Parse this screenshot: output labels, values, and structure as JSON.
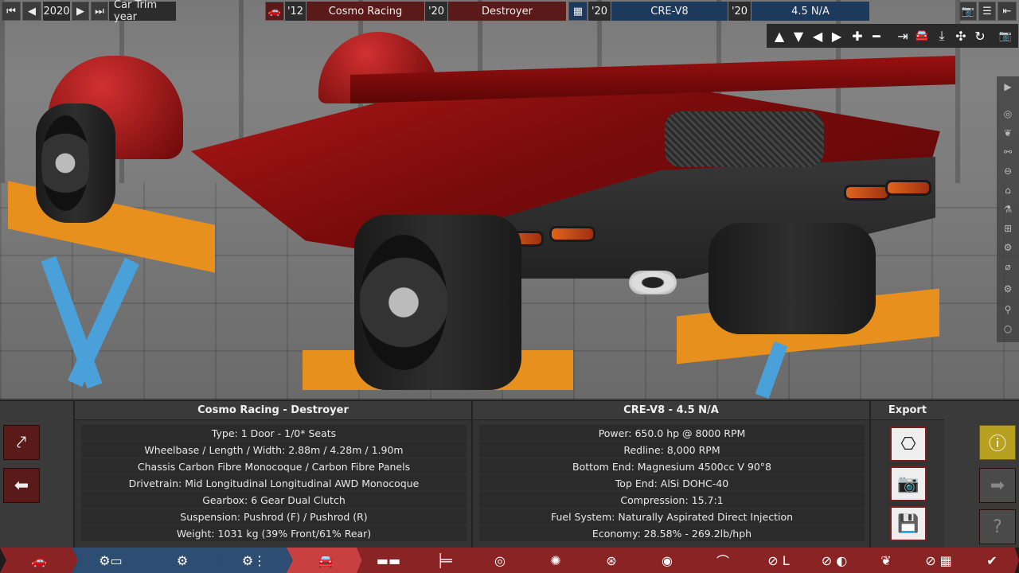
{
  "topbar": {
    "year": "2020",
    "year_label": "Car Trim year",
    "model_year": "'12",
    "brand": "Cosmo Racing",
    "trim_year": "'20",
    "model": "Destroyer",
    "engine_family_year": "'20",
    "engine_family": "CRE-V8",
    "variant_year": "'20",
    "variant": "4.5 N/A",
    "first_icon": "skip-back-icon",
    "prev_icon": "prev-icon",
    "next_icon": "next-icon",
    "last_icon": "skip-forward-icon",
    "car_icon": "car-icon",
    "engine_icon": "engine-icon",
    "camera_icon": "camera-icon",
    "menu_icon": "menu-icon",
    "exit_icon": "exit-icon"
  },
  "camera_controls": [
    "▲",
    "▼",
    "◀",
    "▶",
    "✚",
    "━",
    "⇥",
    "🚘",
    "⤓",
    "✣",
    "↻",
    "📷"
  ],
  "side_tools": [
    "▶",
    "◎",
    "❦",
    "⚯",
    "⊖",
    "⌂",
    "⚗",
    "⊞",
    "⚙",
    "⌀",
    "⚙",
    "⚲",
    "○"
  ],
  "car_panel": {
    "title": "Cosmo Racing - Destroyer",
    "rows": [
      "Type: 1 Door - 1/0* Seats",
      "Wheelbase / Length / Width: 2.88m / 4.28m / 1.90m",
      "Chassis Carbon Fibre Monocoque / Carbon Fibre Panels",
      "Drivetrain: Mid Longitudinal Longitudinal AWD Monocoque",
      "Gearbox: 6 Gear Dual Clutch",
      "Suspension: Pushrod (F) / Pushrod (R)",
      "Weight: 1031 kg (39% Front/61% Rear)"
    ]
  },
  "engine_panel": {
    "title": "CRE-V8 - 4.5 N/A",
    "rows": [
      "Power: 650.0 hp @ 8000 RPM",
      "Redline:  8,000 RPM",
      "Bottom End: Magnesium 4500cc V 90°8",
      "Top End: AlSi DOHC-40",
      "Compression: 15.7:1",
      "Fuel System: Naturally Aspirated Direct Injection",
      "Economy: 28.58% - 269.2lb/hph"
    ]
  },
  "export_panel": {
    "title": "Export",
    "share_icon": "share-icon",
    "photo_icon": "camera-icon",
    "save_icon": "save-icon"
  },
  "left_buttons": {
    "graph_icon": "graph-icon",
    "back_icon": "back-arrow-icon"
  },
  "right_buttons": {
    "warning_icon": "warning-icon",
    "next_icon": "forward-arrow-icon",
    "help_icon": "help-icon"
  },
  "tabs": [
    {
      "icon": "car-body-icon",
      "glyph": "🚗"
    },
    {
      "icon": "chassis-folder-icon",
      "glyph": "⚙▭"
    },
    {
      "icon": "engine-design-icon",
      "glyph": "⚙"
    },
    {
      "icon": "engine-tune-icon",
      "glyph": "⚙⋮"
    },
    {
      "icon": "car-design-icon",
      "glyph": "🚘"
    },
    {
      "icon": "body-icon",
      "glyph": "▬▬"
    },
    {
      "icon": "drivetrain-icon",
      "glyph": "╞═"
    },
    {
      "icon": "headlight-icon",
      "glyph": "◎"
    },
    {
      "icon": "fan-icon",
      "glyph": "✺"
    },
    {
      "icon": "wheel-icon",
      "glyph": "⊛"
    },
    {
      "icon": "brake-icon",
      "glyph": "◉"
    },
    {
      "icon": "aero-icon",
      "glyph": "⌒"
    },
    {
      "icon": "interior-icon",
      "glyph": "⊘ L"
    },
    {
      "icon": "steering-icon",
      "glyph": "⊘ ◐"
    },
    {
      "icon": "fuel-icon",
      "glyph": "❦"
    },
    {
      "icon": "test-track-icon",
      "glyph": "⊘ ▦"
    },
    {
      "icon": "finish-check-icon",
      "glyph": "✔"
    }
  ],
  "colors": {
    "red_tab": "#8a2424",
    "blue_tab": "#2d4d72",
    "warning": "#b8a020"
  }
}
